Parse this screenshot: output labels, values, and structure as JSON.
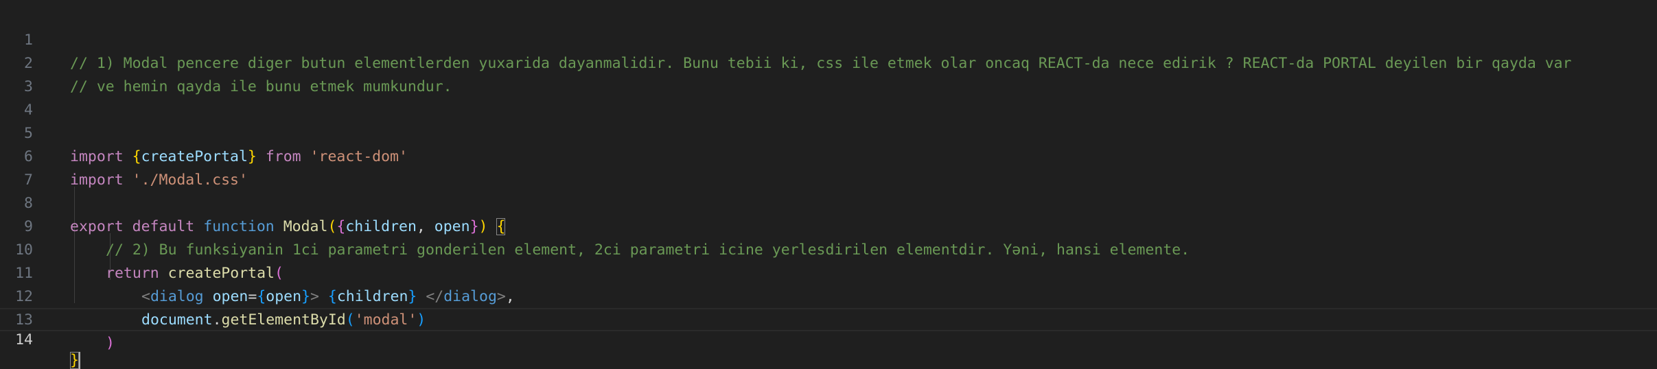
{
  "editor": {
    "language": "javascript",
    "current_line": 14,
    "lines": [
      {
        "n": "1",
        "text": "// 1) Modal pencere diger butun elementlerden yuxarida dayanmalidir. Bunu tebii ki, css ile etmek olar oncaq REACT-da nece edirik ? REACT-da PORTAL deyilen bir qayda var"
      },
      {
        "n": "2",
        "text": "// ve hemin qayda ile bunu etmek mumkundur."
      },
      {
        "n": "3",
        "text": ""
      },
      {
        "n": "4",
        "text": ""
      },
      {
        "n": "5",
        "text": "import {createPortal} from 'react-dom'"
      },
      {
        "n": "6",
        "text": "import './Modal.css'"
      },
      {
        "n": "7",
        "text": ""
      },
      {
        "n": "8",
        "text": "export default function Modal({children, open}) {"
      },
      {
        "n": "9",
        "text": "    // 2) Bu funksiyanin 1ci parametri gonderilen element, 2ci parametri icine yerlesdirilen elementdir. Yəni, hansi elemente."
      },
      {
        "n": "10",
        "text": "    return createPortal("
      },
      {
        "n": "11",
        "text": "        <dialog open={open}> {children} </dialog>,"
      },
      {
        "n": "12",
        "text": "        document.getElementById('modal')"
      },
      {
        "n": "13",
        "text": "    )"
      },
      {
        "n": "14",
        "text": "}"
      }
    ],
    "tokens": {
      "comment1": "// 1) Modal pencere diger butun elementlerden yuxarida dayanmalidir. Bunu tebii ki, css ile etmek olar oncaq REACT-da nece edirik ? REACT-da PORTAL deyilen bir qayda var",
      "comment2": "// ve hemin qayda ile bunu etmek mumkundur.",
      "kw_import": "import",
      "kw_from": "from",
      "kw_export": "export",
      "kw_default": "default",
      "kw_function": "function",
      "kw_return": "return",
      "id_createPortal": "createPortal",
      "id_Modal": "Modal",
      "id_children": "children",
      "id_open": "open",
      "id_document": "document",
      "id_getElementById": "getElementById",
      "tag_dialog": "dialog",
      "attr_open": "open",
      "str_react_dom": "'react-dom'",
      "str_modal_css": "'./Modal.css'",
      "str_modal": "'modal'",
      "comment9": "// 2) Bu funksiyanin 1ci parametri gonderilen element, 2ci parametri icine yerlesdirilen elementdir. Yəni, hansi elemente."
    }
  },
  "colors": {
    "background": "#1f1f1f",
    "comment": "#6a9955",
    "keyword": "#c586c0",
    "string": "#ce9178",
    "function": "#dcdcaa",
    "variable": "#9cdcfe",
    "storage": "#569cd6",
    "bracket1": "#ffd700",
    "bracket2": "#da70d6",
    "bracket3": "#179fff"
  }
}
